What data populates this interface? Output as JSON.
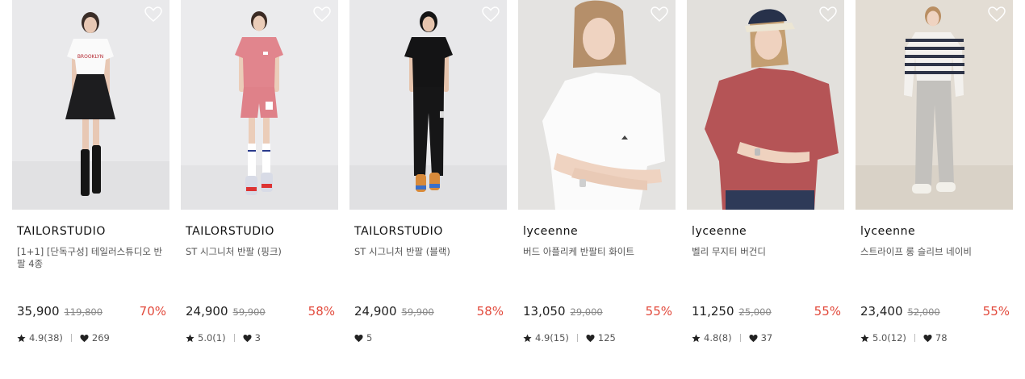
{
  "products": [
    {
      "brand": "TAILORSTUDIO",
      "name": "[1+1] [단독구성] 테일러스튜디오 반팔 4종",
      "price": "35,900",
      "original_price": "119,800",
      "discount": "70%",
      "rating": "4.9(38)",
      "likes": "269",
      "has_rating": true
    },
    {
      "brand": "TAILORSTUDIO",
      "name": "ST 시그니처 반팔 (핑크)",
      "price": "24,900",
      "original_price": "59,900",
      "discount": "58%",
      "rating": "5.0(1)",
      "likes": "3",
      "has_rating": true
    },
    {
      "brand": "TAILORSTUDIO",
      "name": "ST 시그니처 반팔 (블랙)",
      "price": "24,900",
      "original_price": "59,900",
      "discount": "58%",
      "rating": "",
      "likes": "5",
      "has_rating": false
    },
    {
      "brand": "lyceenne",
      "name": "버드 아플리케 반팔티 화이트",
      "price": "13,050",
      "original_price": "29,000",
      "discount": "55%",
      "rating": "4.9(15)",
      "likes": "125",
      "has_rating": true
    },
    {
      "brand": "lyceenne",
      "name": "벨리 무지티 버건디",
      "price": "11,250",
      "original_price": "25,000",
      "discount": "55%",
      "rating": "4.8(8)",
      "likes": "37",
      "has_rating": true
    },
    {
      "brand": "lyceenne",
      "name": "스트라이프 롱 슬리브 네이비",
      "price": "23,400",
      "original_price": "52,000",
      "discount": "55%",
      "rating": "5.0(12)",
      "likes": "78",
      "has_rating": true
    }
  ],
  "colors": {
    "discount": "#e2493b",
    "price": "#222222",
    "original_price": "#888888",
    "brand": "#111111"
  },
  "icons": {
    "wishlist": "heart-outline-icon",
    "rating": "star-icon",
    "likes": "heart-filled-icon"
  }
}
